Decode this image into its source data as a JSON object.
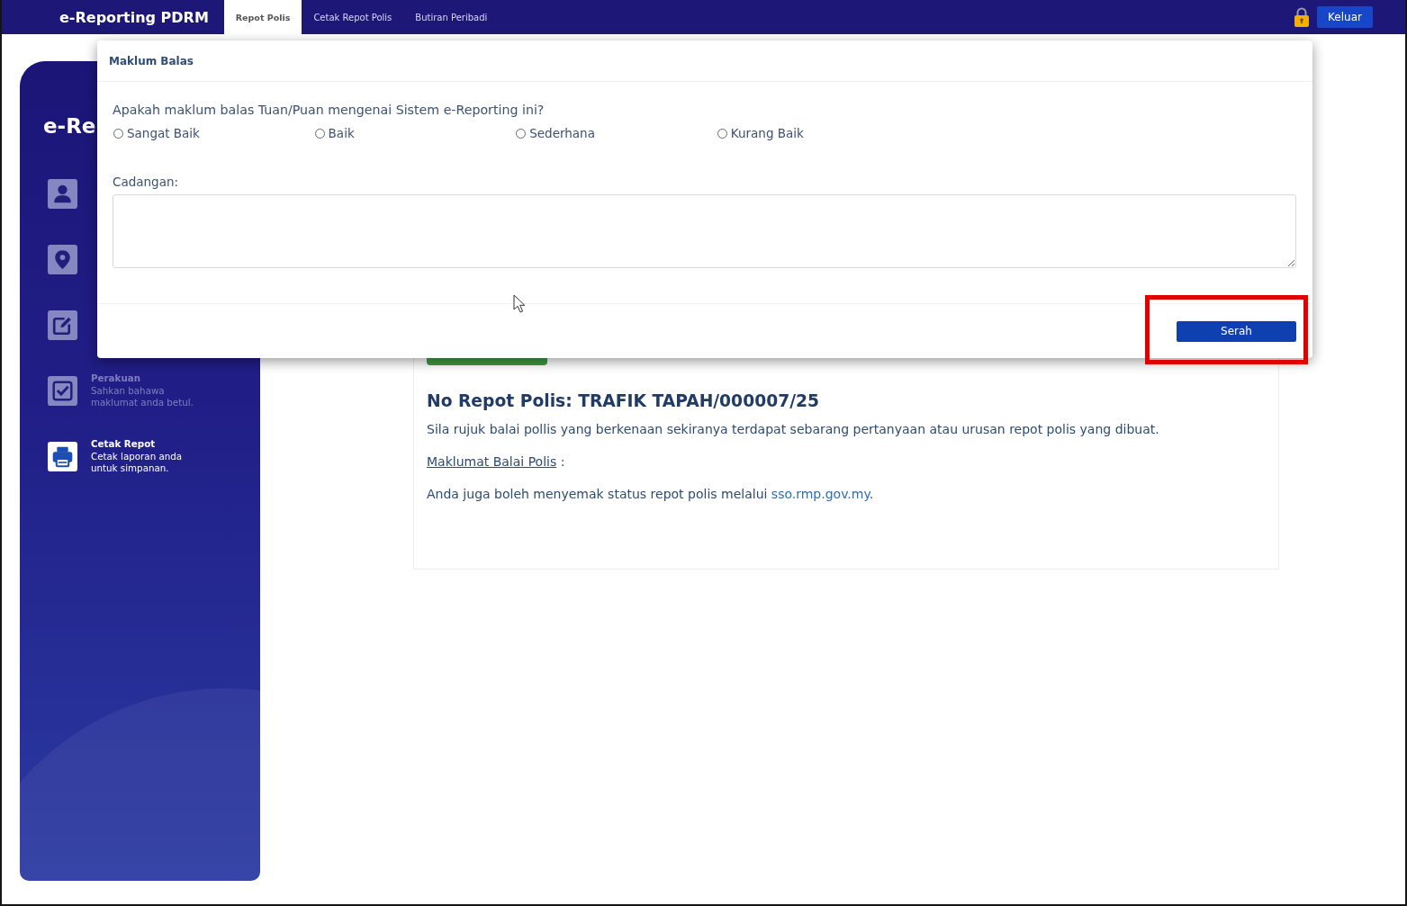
{
  "navbar": {
    "logo": "e-Reporting PDRM",
    "tabs": [
      {
        "label": "Repot Polis",
        "selected": true
      },
      {
        "label": "Cetak Repot Polis",
        "selected": false
      },
      {
        "label": "Butiran Peribadi",
        "selected": false
      }
    ],
    "logout_button": "Keluar"
  },
  "sidebar": {
    "title": "e-Re",
    "items": [
      {
        "kind": "person",
        "active": false
      },
      {
        "kind": "pin",
        "active": false
      },
      {
        "kind": "edit",
        "active": false
      },
      {
        "kind": "check",
        "title": "Perakuan",
        "description": "Sahkan bahawa maklumat anda betul.",
        "active": false
      },
      {
        "kind": "printer",
        "title": "Cetak Repot",
        "description": "Cetak laporan anda untuk simpanan.",
        "active": true
      }
    ]
  },
  "report": {
    "heading": "No Repot Polis: TRAFIK TAPAH/000007/25",
    "instruction": "Sila rujuk balai pollis yang berkenaan sekiranya terdapat sebarang pertanyaan atau urusan repot polis yang dibuat.",
    "station_link": "Maklumat Balai Polis",
    "station_suffix": " :",
    "status_text": "Anda juga boleh menyemak status repot polis melalui",
    "status_link": "sso.rmp.gov.my",
    "status_end": "."
  },
  "modal": {
    "title": "Maklum Balas",
    "question": "Apakah maklum balas Tuan/Puan mengenai Sistem e-Reporting ini?",
    "options": [
      {
        "label": "Sangat Baik",
        "selected": false
      },
      {
        "label": "Baik",
        "selected": false
      },
      {
        "label": "Sederhana",
        "selected": false
      },
      {
        "label": "Kurang Baik",
        "selected": false
      }
    ],
    "suggestion_label": "Cadangan:",
    "submit_button": {
      "label": "Serah",
      "highlighted": true
    }
  }
}
